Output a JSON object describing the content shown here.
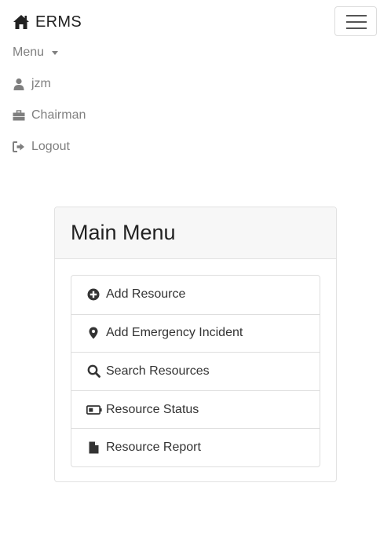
{
  "navbar": {
    "brand": "ERMS",
    "brand_icon": "home-icon",
    "toggler_icon": "hamburger-icon"
  },
  "nav": {
    "menu_label": "Menu",
    "user": {
      "label": "jzm",
      "icon": "user-icon"
    },
    "role": {
      "label": "Chairman",
      "icon": "briefcase-icon"
    },
    "logout": {
      "label": "Logout",
      "icon": "sign-out-icon"
    }
  },
  "main_menu": {
    "title": "Main Menu",
    "items": [
      {
        "label": "Add Resource",
        "icon": "plus-circle-icon"
      },
      {
        "label": "Add Emergency Incident",
        "icon": "map-marker-icon"
      },
      {
        "label": "Search Resources",
        "icon": "search-icon"
      },
      {
        "label": "Resource Status",
        "icon": "battery-icon"
      },
      {
        "label": "Resource Report",
        "icon": "file-icon"
      }
    ]
  },
  "colors": {
    "nav_text": "#7f7f7f",
    "brand_text": "#222222",
    "card_header_bg": "#f7f7f7",
    "border": "#dedede"
  }
}
